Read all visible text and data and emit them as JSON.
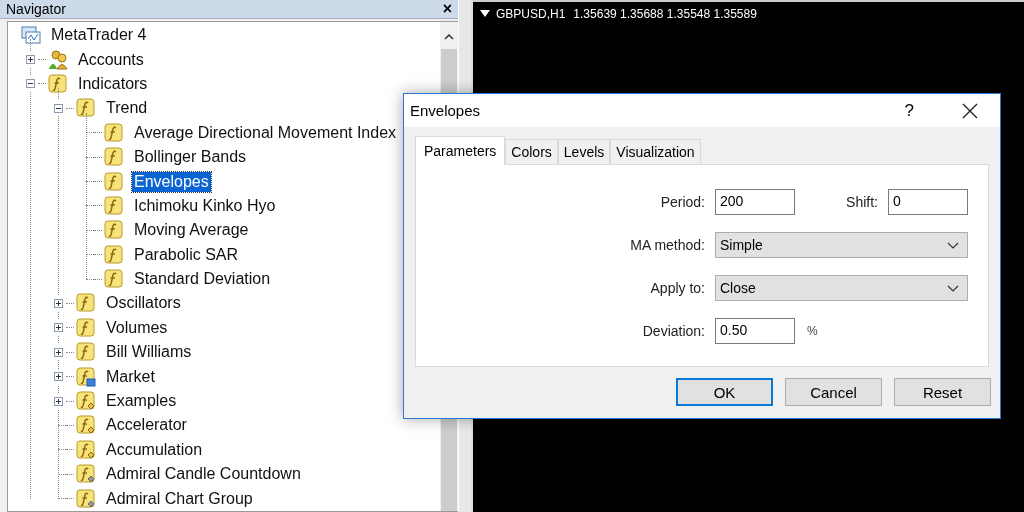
{
  "navigator": {
    "title": "Navigator",
    "close": "×",
    "tree": [
      {
        "label": "MetaTrader 4",
        "kind": "terminal",
        "selected": false,
        "children": [
          {
            "label": "Accounts",
            "kind": "accounts",
            "selected": false,
            "expanded": false
          },
          {
            "label": "Indicators",
            "kind": "indicator",
            "selected": false,
            "expanded": true,
            "children": [
              {
                "label": "Trend",
                "kind": "indicator",
                "selected": false,
                "expanded": true,
                "children": [
                  {
                    "label": "Average Directional Movement Index",
                    "kind": "indicator",
                    "selected": false
                  },
                  {
                    "label": "Bollinger Bands",
                    "kind": "indicator",
                    "selected": false
                  },
                  {
                    "label": "Envelopes",
                    "kind": "indicator",
                    "selected": true
                  },
                  {
                    "label": "Ichimoku Kinko Hyo",
                    "kind": "indicator",
                    "selected": false
                  },
                  {
                    "label": "Moving Average",
                    "kind": "indicator",
                    "selected": false
                  },
                  {
                    "label": "Parabolic SAR",
                    "kind": "indicator",
                    "selected": false
                  },
                  {
                    "label": "Standard Deviation",
                    "kind": "indicator",
                    "selected": false
                  }
                ]
              },
              {
                "label": "Oscillators",
                "kind": "indicator",
                "selected": false,
                "expanded": false
              },
              {
                "label": "Volumes",
                "kind": "indicator",
                "selected": false,
                "expanded": false
              },
              {
                "label": "Bill Williams",
                "kind": "indicator",
                "selected": false,
                "expanded": false
              },
              {
                "label": "Market",
                "kind": "market",
                "selected": false,
                "expanded": false
              },
              {
                "label": "Examples",
                "kind": "custom",
                "selected": false,
                "expanded": false
              },
              {
                "label": "Accelerator",
                "kind": "custom",
                "selected": false
              },
              {
                "label": "Accumulation",
                "kind": "custom",
                "selected": false
              },
              {
                "label": "Admiral Candle Countdown",
                "kind": "custom-gray",
                "selected": false
              },
              {
                "label": "Admiral Chart Group",
                "kind": "custom-gray",
                "selected": false
              }
            ]
          }
        ]
      }
    ]
  },
  "chart": {
    "symbol": "GBPUSD,H1",
    "prices": "1.35639 1.35688 1.35548 1.35589"
  },
  "dialog": {
    "title": "Envelopes",
    "help": "?",
    "tabs": [
      {
        "label": "Parameters",
        "selected": true
      },
      {
        "label": "Colors",
        "selected": false
      },
      {
        "label": "Levels",
        "selected": false
      },
      {
        "label": "Visualization",
        "selected": false
      }
    ],
    "rows": [
      [
        {
          "label": "Period:",
          "kind": "text",
          "value": "200"
        },
        {
          "label": "Shift:",
          "kind": "text",
          "value": "0"
        }
      ],
      [
        {
          "label": "MA method:",
          "kind": "select",
          "value": "Simple"
        }
      ],
      [
        {
          "label": "Apply to:",
          "kind": "select",
          "value": "Close"
        }
      ],
      [
        {
          "label": "Deviation:",
          "kind": "text",
          "value": "0.50",
          "suffix": "%"
        }
      ]
    ],
    "buttons": [
      {
        "label": "OK",
        "default": true
      },
      {
        "label": "Cancel",
        "default": false
      },
      {
        "label": "Reset",
        "default": false
      }
    ]
  }
}
